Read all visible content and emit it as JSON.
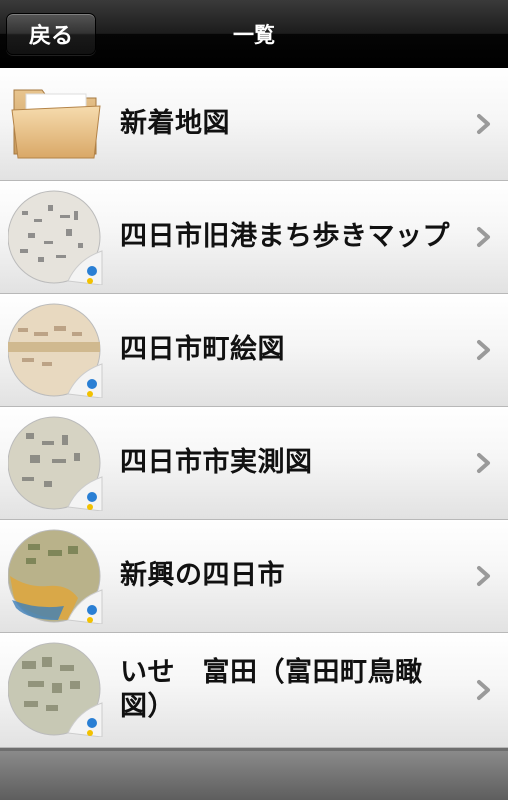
{
  "navbar": {
    "back_label": "戻る",
    "title": "一覧"
  },
  "items": [
    {
      "label": "新着地図",
      "icon": "folder-icon"
    },
    {
      "label": "四日市旧港まち歩きマップ",
      "icon": "map-thumbnail-icon"
    },
    {
      "label": "四日市町絵図",
      "icon": "map-thumbnail-icon"
    },
    {
      "label": "四日市市実測図",
      "icon": "map-thumbnail-icon"
    },
    {
      "label": "新興の四日市",
      "icon": "map-thumbnail-icon"
    },
    {
      "label": "いせ　富田（富田町鳥瞰図）",
      "icon": "map-thumbnail-icon"
    }
  ],
  "colors": {
    "navbar": "#111111",
    "row_background": "#f2f2f2",
    "chevron": "#9a9a9a",
    "badge_blue": "#2a7fd4",
    "badge_yellow": "#f2c100"
  }
}
